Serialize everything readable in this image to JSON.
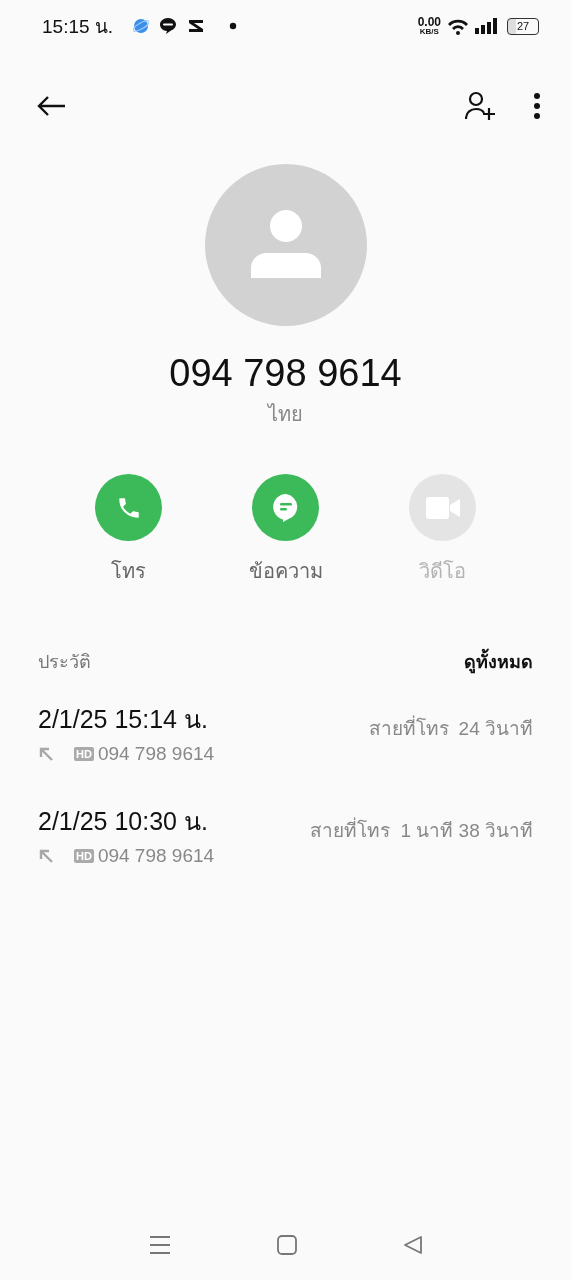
{
  "status_bar": {
    "time": "15:15 น.",
    "net_speed": "0.00",
    "net_unit": "KB/S",
    "battery": "27"
  },
  "contact": {
    "number": "094 798 9614",
    "location": "ไทย"
  },
  "actions": [
    {
      "kind": "call",
      "label": "โทร",
      "disabled": false
    },
    {
      "kind": "message",
      "label": "ข้อความ",
      "disabled": false
    },
    {
      "kind": "video",
      "label": "วิดีโอ",
      "disabled": true
    }
  ],
  "history": {
    "title": "ประวัติ",
    "see_all": "ดูทั้งหมด",
    "calls": [
      {
        "datetime": "2/1/25 15:14 น.",
        "kind": "outgoing",
        "hd": "HD",
        "number": "094 798 9614",
        "call_type": "สายที่โทร",
        "duration": "24 วินาที"
      },
      {
        "datetime": "2/1/25 10:30 น.",
        "kind": "outgoing",
        "hd": "HD",
        "number": "094 798 9614",
        "call_type": "สายที่โทร",
        "duration": "1 นาที 38 วินาที"
      }
    ]
  }
}
